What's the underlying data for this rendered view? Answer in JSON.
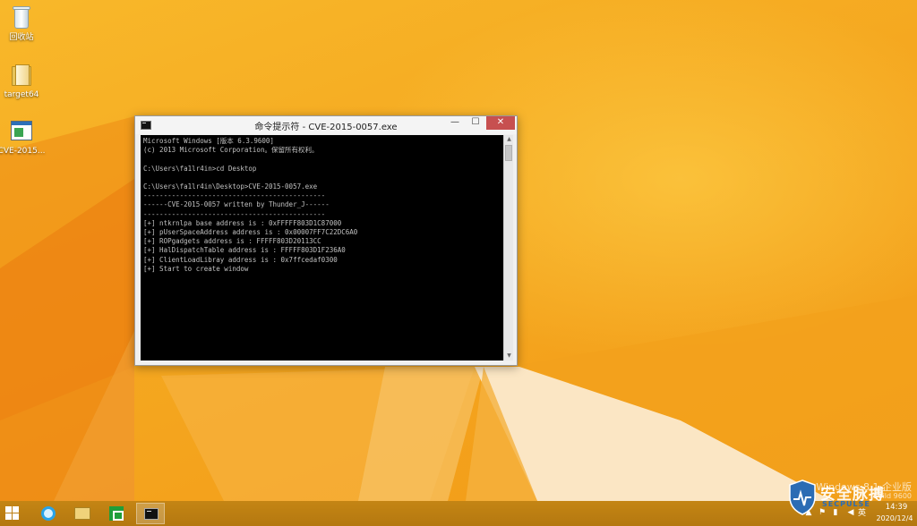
{
  "desktop": {
    "icons": [
      {
        "label": "回收站",
        "icon": "recycle-bin-icon"
      },
      {
        "label": "target64",
        "icon": "folder-icon"
      },
      {
        "label": "CVE-2015...",
        "icon": "exe-icon"
      }
    ]
  },
  "cmd_window": {
    "title": "命令提示符 - CVE-2015-0057.exe",
    "minimize_glyph": "—",
    "maximize_glyph": "☐",
    "close_glyph": "✕",
    "scroll_up_glyph": "▲",
    "scroll_down_glyph": "▼",
    "console_lines": [
      "Microsoft Windows [版本 6.3.9600]",
      "(c) 2013 Microsoft Corporation。保留所有权利。",
      "",
      "C:\\Users\\fa1lr4in>cd Desktop",
      "",
      "C:\\Users\\fa1lr4in\\Desktop>CVE-2015-0057.exe",
      "---------------------------------------------",
      "------CVE-2015-0057 written by Thunder_J------",
      "---------------------------------------------",
      "[+] ntkrnlpa base address is : 0xFFFFF803D1C87000",
      "[+] pUserSpaceAddress address is : 0x00007FF7C22DC6A0",
      "[+] ROPgadgets address is : FFFFF803D20113CC",
      "[+] HalDispatchTable address is : FFFFF803D1F236A0",
      "[+] ClientLoadLibray address is : 0x7ffcedaf0300",
      "[+] Start to create window"
    ]
  },
  "watermark": {
    "edition": "Windows 8.1 企业版",
    "build": "Build 9600",
    "logo_text": "安全脉搏",
    "logo_sub": "SECPULSE"
  },
  "taskbar": {
    "items": [
      {
        "icon": "start-icon"
      },
      {
        "icon": "internet-explorer-icon"
      },
      {
        "icon": "file-explorer-icon"
      },
      {
        "icon": "store-icon"
      },
      {
        "icon": "command-prompt-icon"
      }
    ],
    "tray": {
      "show_hidden_glyph": "▲",
      "flag_glyph": "⚑",
      "network_glyph": "▮",
      "volume_glyph": "◀",
      "ime": "英"
    },
    "clock": {
      "time": "14:39",
      "date": "2020/12/4"
    }
  },
  "colors": {
    "wallpaper": "#f5a820",
    "taskbar": "#b47810",
    "console_bg": "#000000",
    "console_fg": "#c0c0c0",
    "close_button": "#c75050"
  }
}
